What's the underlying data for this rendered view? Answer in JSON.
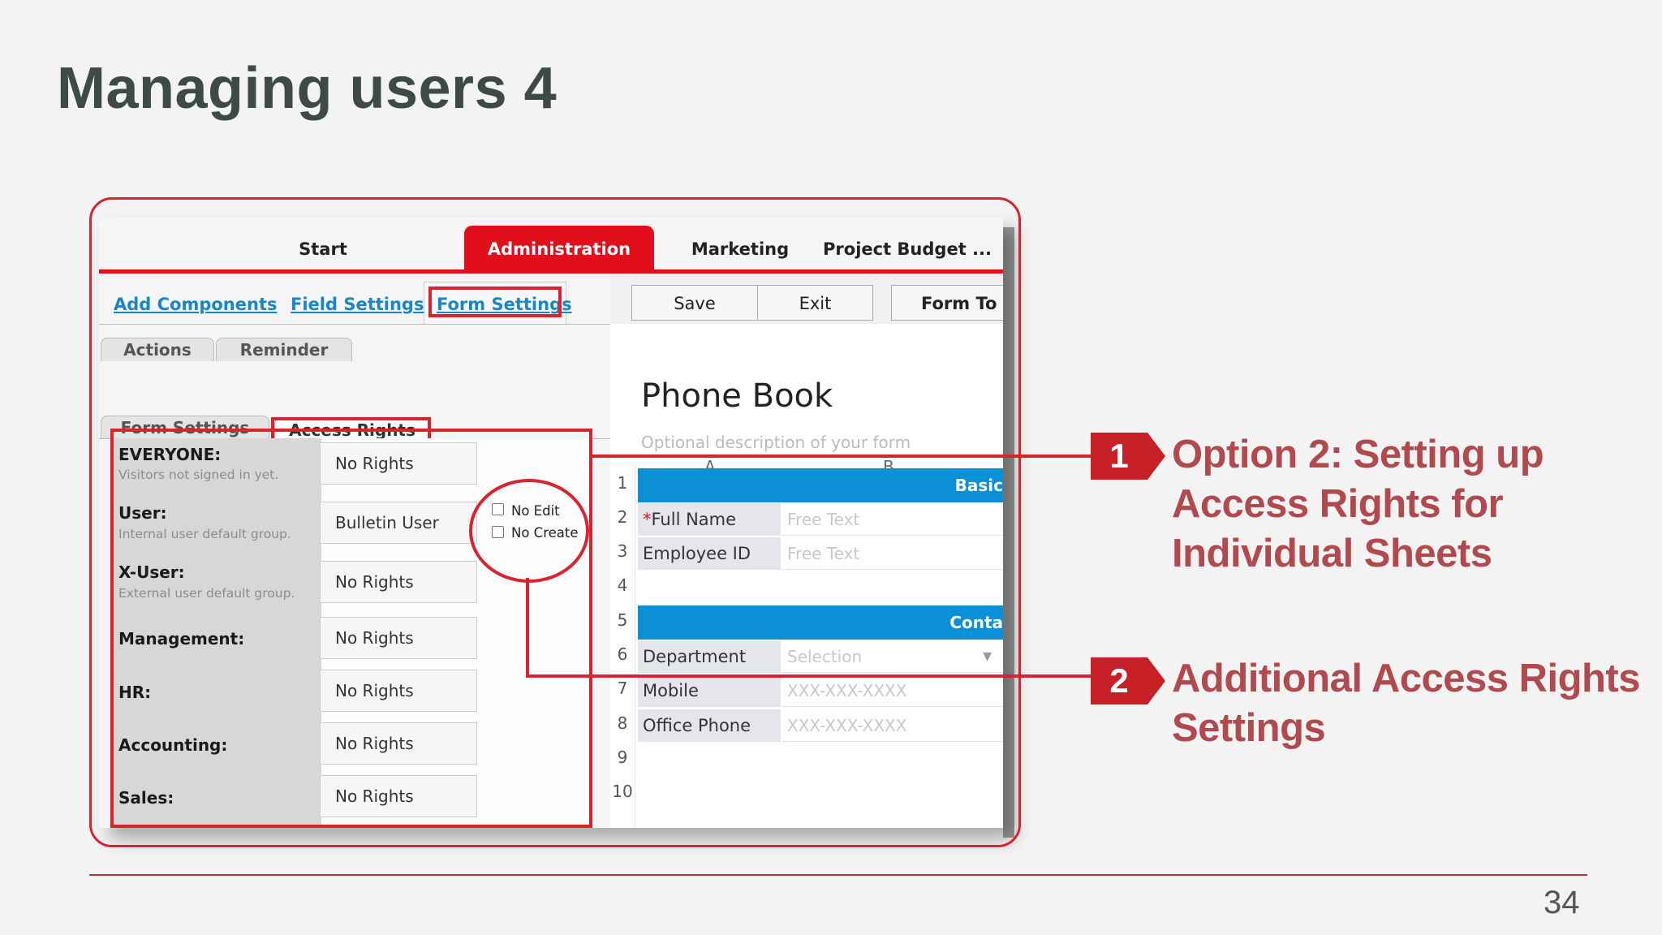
{
  "slide": {
    "title": "Managing users 4",
    "page_number": "34"
  },
  "app": {
    "top_tabs": [
      "Start",
      "Administration",
      "Marketing",
      "Project Budget ..."
    ],
    "active_top_tab": "Administration",
    "link_tabs": [
      "Add Components",
      "Field Settings",
      "Form Settings"
    ],
    "active_link_tab": "Form Settings",
    "sub_tabs_row1": [
      "Actions",
      "Reminder"
    ],
    "sub_tabs_row2": [
      "Form Settings",
      "Access Rights"
    ],
    "active_sub_tab": "Access Rights",
    "permissions": [
      {
        "name": "EVERYONE",
        "desc": "Visitors not signed in yet.",
        "value": "No Rights"
      },
      {
        "name": "User",
        "desc": "Internal user default group.",
        "value": "Bulletin User"
      },
      {
        "name": "X-User",
        "desc": "External user default group.",
        "value": "No Rights"
      },
      {
        "name": "Management",
        "desc": "",
        "value": "No Rights"
      },
      {
        "name": "HR",
        "desc": "",
        "value": "No Rights"
      },
      {
        "name": "Accounting",
        "desc": "",
        "value": "No Rights"
      },
      {
        "name": "Sales",
        "desc": "",
        "value": "No Rights"
      }
    ],
    "checkboxes": [
      "No Edit",
      "No Create"
    ],
    "toolbar": {
      "save": "Save",
      "exit": "Exit",
      "form_tools": "Form To"
    },
    "form": {
      "title": "Phone Book",
      "description_placeholder": "Optional description of your form",
      "columns": [
        "A",
        "B"
      ],
      "row_numbers": [
        "1",
        "2",
        "3",
        "4",
        "5",
        "6",
        "7",
        "8",
        "9",
        "10"
      ],
      "sections": [
        "Basic",
        "Conta"
      ],
      "fields": [
        {
          "label": "Full Name",
          "required": true,
          "placeholder": "Free Text"
        },
        {
          "label": "Employee ID",
          "required": false,
          "placeholder": "Free Text"
        },
        {
          "label": "Department",
          "required": false,
          "placeholder": "Selection"
        },
        {
          "label": "Mobile",
          "required": false,
          "placeholder": "XXX-XXX-XXXX"
        },
        {
          "label": "Office Phone",
          "required": false,
          "placeholder": "XXX-XXX-XXXX"
        }
      ],
      "required_marker": "*"
    }
  },
  "callouts": [
    {
      "number": "1",
      "lines": [
        "Option 2: Setting up",
        "Access Rights for",
        "Individual Sheets"
      ]
    },
    {
      "number": "2",
      "lines": [
        "Additional Access Rights",
        "Settings"
      ]
    }
  ],
  "colors": {
    "accent_red": "#e00f1b",
    "callout_red": "#c72027",
    "callout_text": "#b04a4e",
    "section_blue": "#0b8fd5",
    "link_blue": "#1a86c8"
  }
}
